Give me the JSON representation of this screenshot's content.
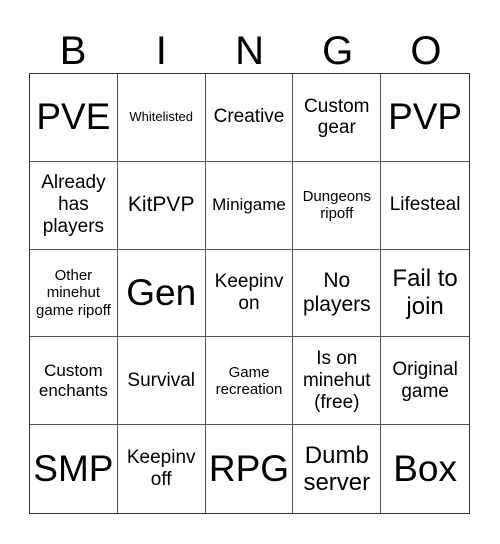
{
  "header": {
    "letters": [
      "B",
      "I",
      "N",
      "G",
      "O"
    ]
  },
  "cells": [
    {
      "text": "PVE",
      "size": "s-xl"
    },
    {
      "text": "Whitelisted",
      "size": "s-xxs"
    },
    {
      "text": "Creative",
      "size": "s-n"
    },
    {
      "text": "Custom gear",
      "size": "s-n"
    },
    {
      "text": "PVP",
      "size": "s-xl"
    },
    {
      "text": "Already has players",
      "size": "s-n"
    },
    {
      "text": "KitPVP",
      "size": "s-m"
    },
    {
      "text": "Minigame",
      "size": "s-s"
    },
    {
      "text": "Dungeons ripoff",
      "size": "s-xs"
    },
    {
      "text": "Lifesteal",
      "size": "s-n"
    },
    {
      "text": "Other minehut game ripoff",
      "size": "s-xs"
    },
    {
      "text": "Gen",
      "size": "s-xl"
    },
    {
      "text": "Keepinv on",
      "size": "s-n"
    },
    {
      "text": "No players",
      "size": "s-m"
    },
    {
      "text": "Fail to join",
      "size": "s-m2"
    },
    {
      "text": "Custom enchants",
      "size": "s-s"
    },
    {
      "text": "Survival",
      "size": "s-n"
    },
    {
      "text": "Game recreation",
      "size": "s-xs"
    },
    {
      "text": "Is on minehut (free)",
      "size": "s-n"
    },
    {
      "text": "Original game",
      "size": "s-n"
    },
    {
      "text": "SMP",
      "size": "s-xl"
    },
    {
      "text": "Keepinv off",
      "size": "s-n"
    },
    {
      "text": "RPG",
      "size": "s-xl"
    },
    {
      "text": "Dumb server",
      "size": "s-m2"
    },
    {
      "text": "Box",
      "size": "s-xl"
    }
  ]
}
